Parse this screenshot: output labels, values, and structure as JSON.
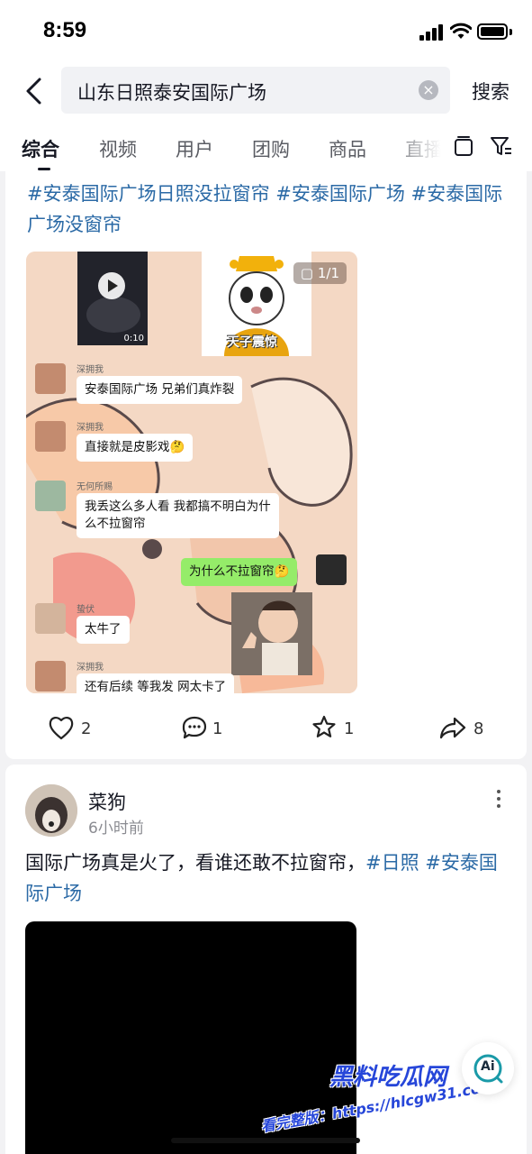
{
  "status_bar": {
    "time": "8:59"
  },
  "search": {
    "query": "山东日照泰安国际广场",
    "search_button": "搜索"
  },
  "tabs": [
    {
      "label": "综合",
      "active": true
    },
    {
      "label": "视频"
    },
    {
      "label": "用户"
    },
    {
      "label": "团购"
    },
    {
      "label": "商品"
    },
    {
      "label": "直播"
    }
  ],
  "post1": {
    "hashtags_text": "#安泰国际广场日照没拉窗帘 #安泰国际广场 #安泰国际广场没窗帘",
    "image_counter": "1/1",
    "video_duration": "0:10",
    "sticker_caption": "天子震惊",
    "chat": [
      {
        "nick": "深拥我",
        "text": "安泰国际广场 兄弟们真炸裂"
      },
      {
        "nick": "深拥我",
        "text": "直接就是皮影戏🤔"
      },
      {
        "nick": "无何所赐",
        "text_line1": "我丢这么多人看 我都搞不明白为什",
        "text_line2": "么不拉窗帘"
      },
      {
        "nick": "",
        "text": "为什么不拉窗帘🤔",
        "self": true
      },
      {
        "nick": "蛰伏",
        "text": "太牛了"
      },
      {
        "nick": "深拥我",
        "text": "还有后续 等我发 网太卡了"
      }
    ],
    "likes": "2",
    "comments": "1",
    "favorites": "1",
    "shares": "8"
  },
  "post2": {
    "author": "菜狗",
    "time": "6小时前",
    "text_plain": "国际广场真是火了，看谁还敢不拉窗帘，",
    "tag1": "#日照",
    "tag2": "#安泰国际广场"
  },
  "watermark": {
    "line1": "黑料吃瓜网",
    "line2": "看完整版：https://hlcgw31.com"
  },
  "ai_button": {
    "label": "Ai"
  },
  "colors": {
    "hashtag": "#2b6aa6",
    "chat_green": "#95ec69",
    "watermark": "#2646d9"
  }
}
